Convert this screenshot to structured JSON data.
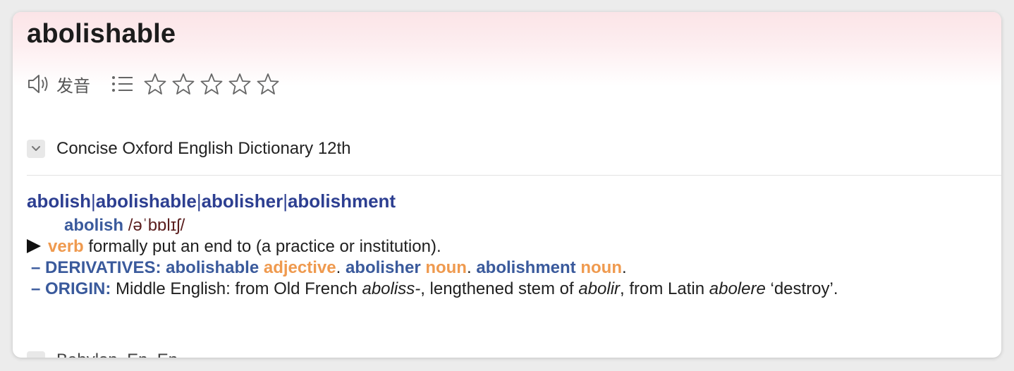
{
  "entry": {
    "headword": "abolishable"
  },
  "toolbar": {
    "pronounce_label": "发音",
    "star_count": 5
  },
  "sections": [
    {
      "title": "Concise Oxford English Dictionary 12th",
      "word_forms": [
        "abolish",
        "abolishable",
        "abolisher",
        "abolishment"
      ],
      "headword": "abolish",
      "pronunciation": "/əˈbɒlɪʃ/",
      "sense": {
        "marker": "▶",
        "pos": "verb",
        "definition": "formally put an end to (a practice or institution)."
      },
      "derivatives": {
        "label": "– DERIVATIVES:",
        "items": [
          {
            "word": "abolishable",
            "pos": "adjective"
          },
          {
            "word": "abolisher",
            "pos": "noun"
          },
          {
            "word": "abolishment",
            "pos": "noun"
          }
        ]
      },
      "origin": {
        "label": "– ORIGIN:",
        "text_1": "Middle English: from Old French ",
        "italic_1": "aboliss-",
        "text_2": ", lengthened stem of ",
        "italic_2": "abolir",
        "text_3": ", from Latin ",
        "italic_3": "abolere",
        "text_4": " ‘destroy’."
      }
    },
    {
      "title": "Babylon_En_En"
    }
  ],
  "colors": {
    "header_tint": "#fbe4e7",
    "word_forms": "#2d3f91",
    "headword_blue": "#3a5a9c",
    "pos_orange": "#ef9a4f",
    "pronunciation": "#5a1e1e"
  }
}
